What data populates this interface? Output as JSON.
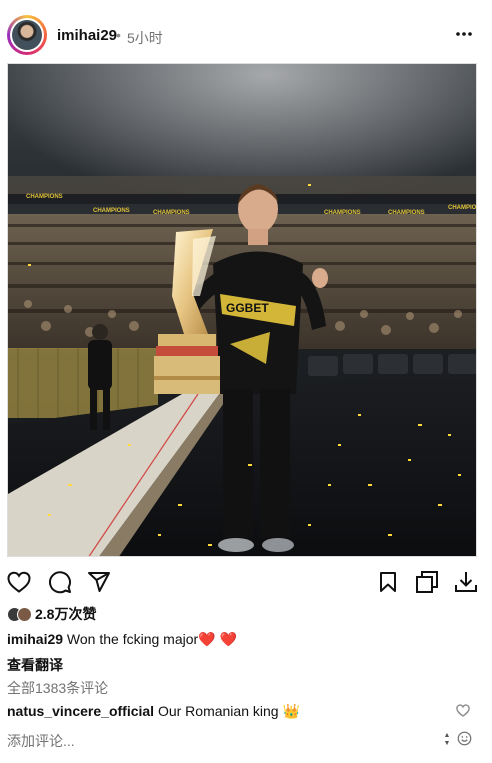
{
  "post": {
    "username": "imihai29",
    "separator": "•",
    "time_ago": "5小时",
    "more_label": "•••"
  },
  "photo": {
    "banner_text": "CHAMPIONS",
    "jersey_sponsor": "GGBET"
  },
  "likes": {
    "count_label": "2.8万次赞"
  },
  "caption": {
    "username": "imihai29",
    "text": "Won the fcking major",
    "emoji": "❤️ ❤️"
  },
  "translate_label": "查看翻译",
  "comments": {
    "view_all_label": "全部1383条评论",
    "top_comment": {
      "username": "natus_vincere_official",
      "text": "Our Romanian king",
      "emoji": "👑"
    }
  },
  "add_comment": {
    "placeholder": "添加评论..."
  },
  "colors": {
    "heart_red": "#ed1c24",
    "secondary_text": "#737373"
  },
  "icons": {
    "like": "heart-icon",
    "comment": "comment-bubble-icon",
    "share": "paper-plane-icon",
    "save": "bookmark-icon",
    "copy": "copy-icon",
    "download": "download-icon",
    "emoji": "smiley-icon"
  }
}
